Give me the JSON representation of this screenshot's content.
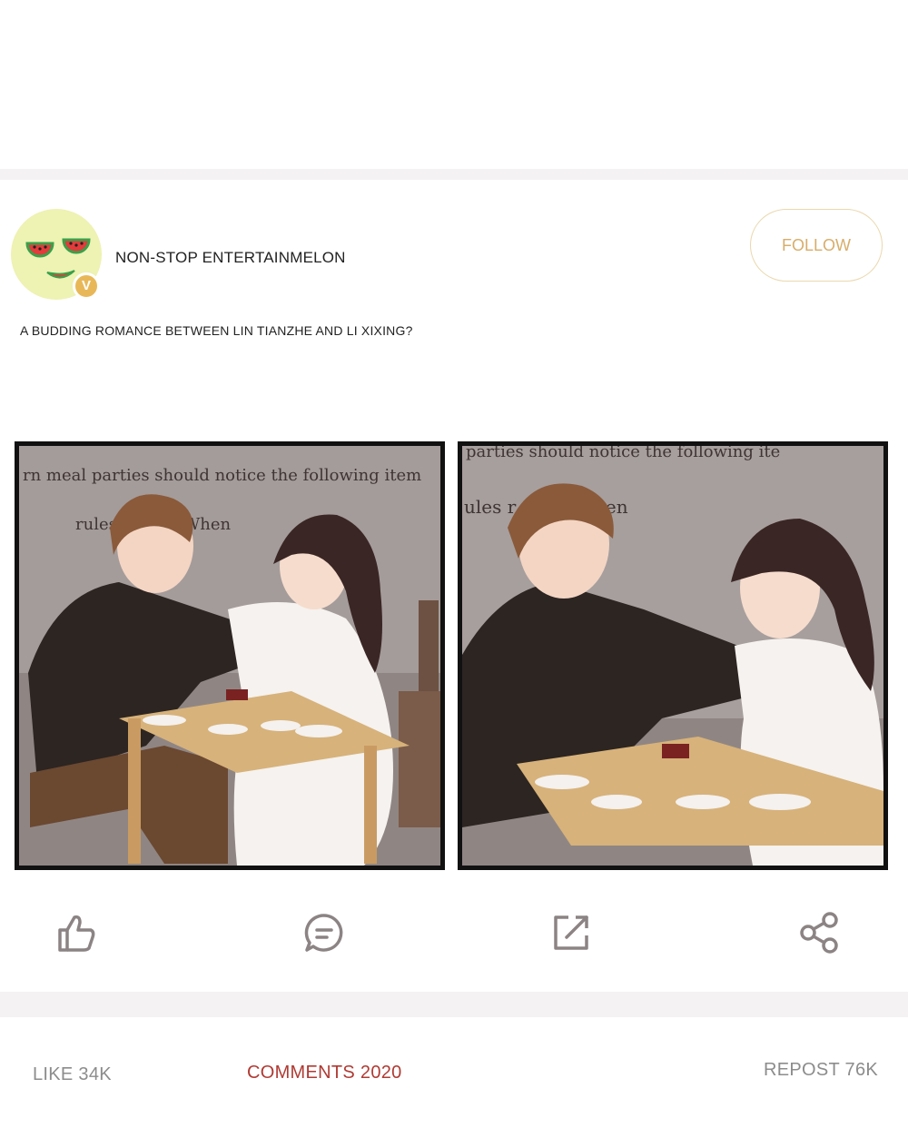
{
  "post": {
    "username": "NON-STOP ENTERTAINMELON",
    "follow_label": "FOLLOW",
    "caption": "A BUDDING ROMANCE BETWEEN LIN TIANZHE AND LI XIXING?",
    "panel_1_wall_text_line1": "rn meal parties should notice the following item",
    "panel_1_wall_text_line2": "rules          r many.When",
    "panel_2_wall_text_line1": "parties should notice the following ite",
    "panel_2_wall_text_line2": "ules             r many.When"
  },
  "actions": {
    "like_icon": "thumbs-up-icon",
    "comment_icon": "comment-bubble-icon",
    "repost_icon": "repost-arrow-icon",
    "share_icon": "share-icon"
  },
  "stats": {
    "like_label": "LIKE 34K",
    "comments_label": "COMMENTS 2020",
    "repost_label": "REPOST 76K"
  },
  "colors": {
    "follow_accent": "#d7ad6a",
    "comments_accent": "#b03a33",
    "icon_gray": "#8c8484"
  }
}
